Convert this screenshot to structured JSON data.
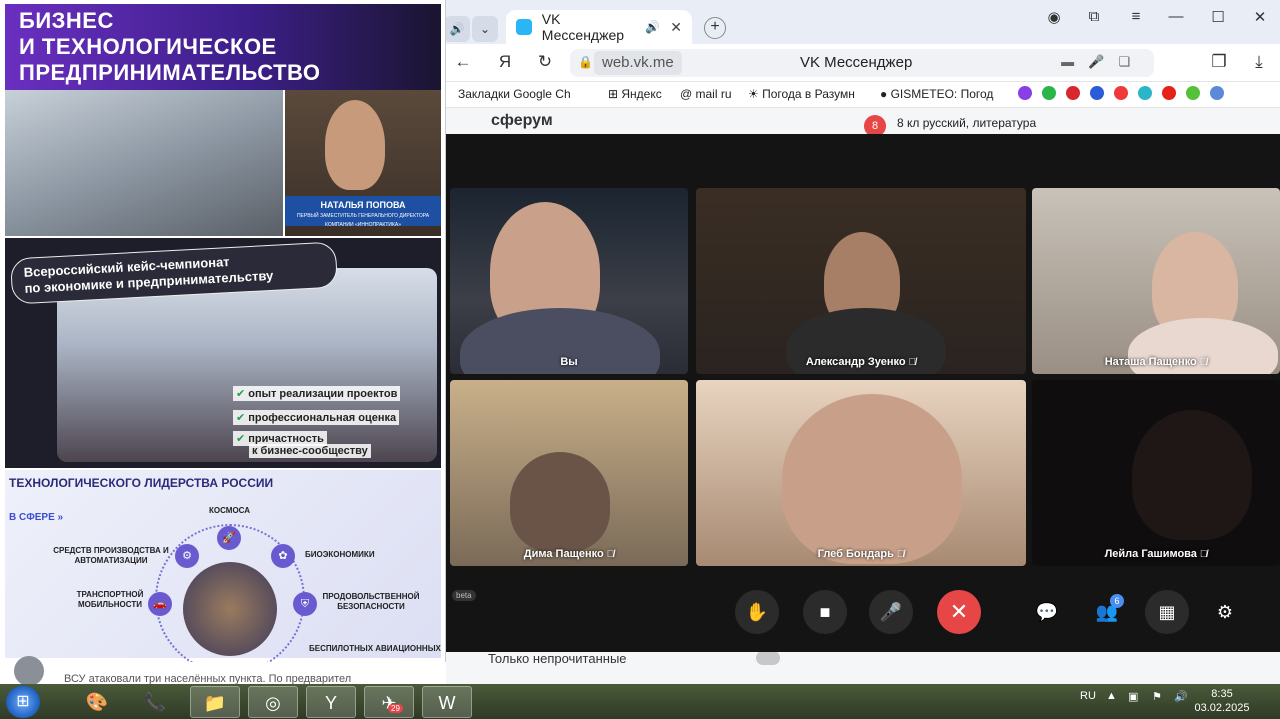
{
  "browser": {
    "tab_title": "VK Мессенджер",
    "url_host": "web.vk.me",
    "page_title": "VK Мессенджер",
    "new_tab": "+"
  },
  "bookmarks": [
    "Закладки Google Ch",
    "Яндекс",
    "mail ru",
    "Погода в Разумн",
    "GISMETEO: Погод"
  ],
  "vk": {
    "logo": "сферум",
    "chat_badge": "8",
    "chat_title": "8 кл русский, литература",
    "unread_label": "Только непрочитанные"
  },
  "call": {
    "beta_label": "beta",
    "participants_badge": "6",
    "tiles": [
      {
        "name": "Вы"
      },
      {
        "name": "Александр Зуенко"
      },
      {
        "name": "Наташа Пащенко"
      },
      {
        "name": "Дима Пащенко"
      },
      {
        "name": "Глеб Бондарь"
      },
      {
        "name": "Лейла Гашимова"
      }
    ]
  },
  "left_image": {
    "banner_line1": "БИЗНЕС",
    "banner_line2": "И ТЕХНОЛОГИЧЕСКОЕ",
    "banner_line3": "ПРЕДПРИНИМАТЕЛЬСТВО",
    "speaker_name": "НАТАЛЬЯ ПОПОВА",
    "speaker_role": "ПЕРВЫЙ ЗАМЕСТИТЕЛЬ ГЕНЕРАЛЬНОГО ДИРЕКТОРА КОМПАНИИ «ИННОПРАКТИКА»",
    "champ_line1": "Всероссийский кейс-чемпионат",
    "champ_line2": "по экономике и предпринимательству",
    "bullets": [
      "опыт реализации проектов",
      "профессиональная оценка",
      "причастность",
      "к бизнес-сообществу"
    ],
    "leadership_title": "ТЕХНОЛОГИЧЕСКОГО ЛИДЕРСТВА РОССИИ",
    "sphere_label": "В СФЕРЕ",
    "items": [
      "КОСМОСА",
      "СРЕДСТВ ПРОИЗВОДСТВА И АВТОМАТИЗАЦИИ",
      "БИОЭКОНОМИКИ",
      "ТРАНСПОРТНОЙ МОБИЛЬНОСТИ",
      "ПРОДОВОЛЬСТВЕННОЙ БЕЗОПАСНОСТИ",
      "БЕСПИЛОТНЫХ АВИАЦИОННЫХ"
    ]
  },
  "peek": {
    "text": "ВСУ атаковали три населённых пункта. По предварител"
  },
  "taskbar": {
    "telegram_badge": "29",
    "lang": "RU",
    "time": "8:35",
    "date": "03.02.2025"
  }
}
